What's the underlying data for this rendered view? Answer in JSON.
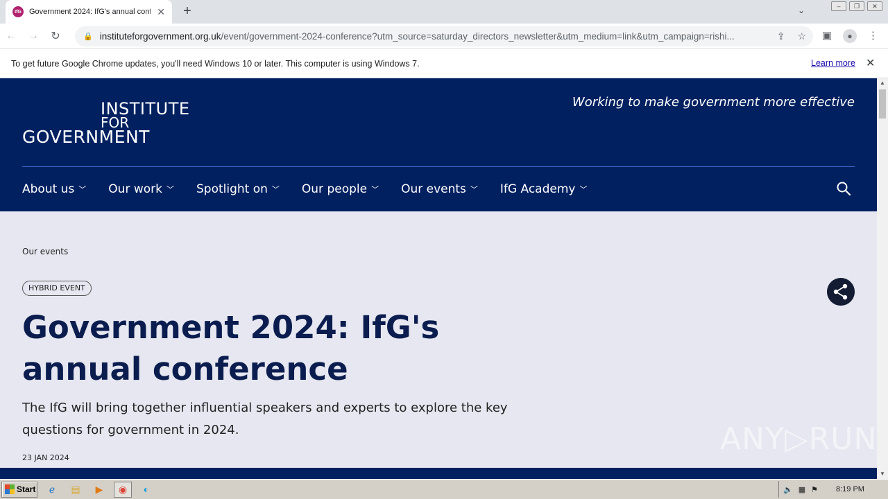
{
  "browser": {
    "tab_title": "Government 2024: IfG's annual conf",
    "favicon_text": "IfG",
    "url_host": "instituteforgovernment.org.uk",
    "url_path": "/event/government-2024-conference?utm_source=saturday_directors_newsletter&utm_medium=link&utm_campaign=rishi...",
    "new_tab": "+",
    "info_message": "To get future Google Chrome updates, you'll need Windows 10 or later. This computer is using Windows 7.",
    "learn_more": "Learn more"
  },
  "site": {
    "logo_line1": "INSTITUTE",
    "logo_line2": "FOR",
    "logo_line3": "GOVERNMENT",
    "tagline": "Working to make government more effective",
    "nav": [
      {
        "label": "About us"
      },
      {
        "label": "Our work"
      },
      {
        "label": "Spotlight on"
      },
      {
        "label": "Our people"
      },
      {
        "label": "Our events"
      },
      {
        "label": "IfG Academy"
      }
    ]
  },
  "event": {
    "breadcrumb": "Our events",
    "badge": "HYBRID EVENT",
    "title": "Government 2024: IfG's annual conference",
    "lead": "The IfG will bring together influential speakers and experts to explore the key questions for government in 2024.",
    "date": "23 JAN 2024"
  },
  "watermark": "ANY▷RUN",
  "taskbar": {
    "start": "Start",
    "clock": "8:19 PM"
  },
  "colors": {
    "brand_navy": "#002060",
    "title_navy": "#0b1d4f",
    "page_bg": "#e6e7f0"
  }
}
